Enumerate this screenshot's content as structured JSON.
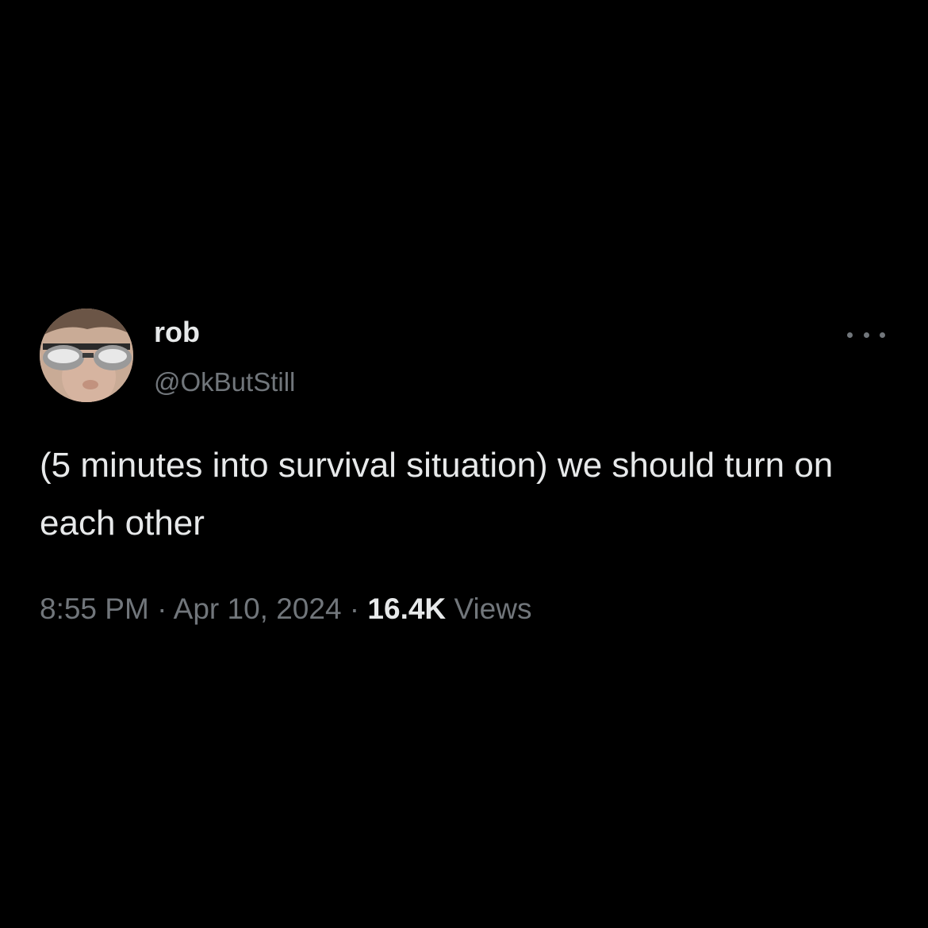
{
  "author": {
    "display_name": "rob",
    "handle": "@OkButStill",
    "avatar_icon": "profile-photo-with-sunglasses"
  },
  "actions": {
    "more_icon": "more-horizontal-icon"
  },
  "tweet": {
    "text": "(5 minutes into survival situation) we should turn on each other",
    "time": "8:55 PM",
    "separator": " · ",
    "date": "Apr 10, 2024",
    "views_count": "16.4K",
    "views_label": "Views"
  },
  "colors": {
    "background": "#000000",
    "primary_text": "#e7e9ea",
    "secondary_text": "#71767b"
  }
}
